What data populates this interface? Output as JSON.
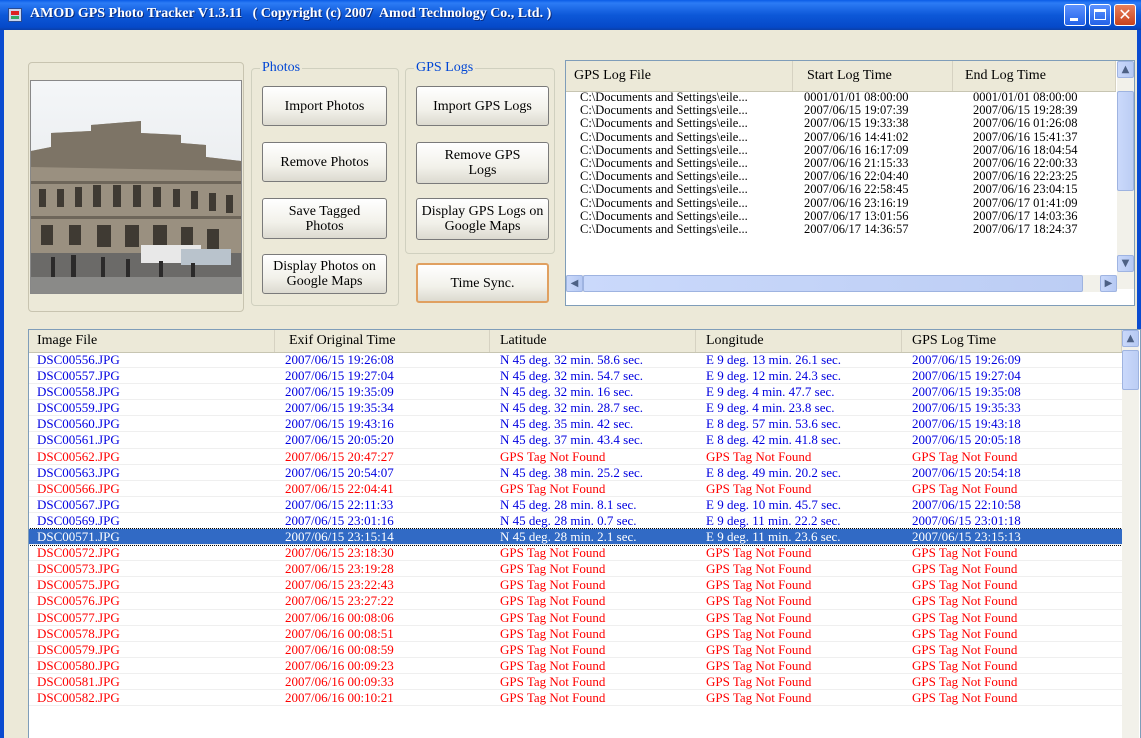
{
  "window": {
    "title": "AMOD GPS Photo Tracker V1.3.11   ( Copyright (c) 2007  Amod Technology Co., Ltd. )",
    "close_glyph": "✕"
  },
  "photos_group": {
    "label": "Photos",
    "import_label": "Import Photos",
    "remove_label": "Remove Photos",
    "save_label": "Save Tagged Photos",
    "display_label": "Display Photos on Google Maps"
  },
  "gps_group": {
    "label": "GPS Logs",
    "import_label": "Import GPS Logs",
    "remove_label": "Remove GPS Logs",
    "display_label": "Display GPS Logs on Google Maps",
    "timesync_label": "Time Sync."
  },
  "log_table": {
    "columns": [
      "GPS Log File",
      "Start Log Time",
      "End Log Time"
    ],
    "rows": [
      [
        "C:\\Documents and Settings\\eile...",
        "0001/01/01 08:00:00",
        "0001/01/01 08:00:00"
      ],
      [
        "C:\\Documents and Settings\\eile...",
        "2007/06/15 19:07:39",
        "2007/06/15 19:28:39"
      ],
      [
        "C:\\Documents and Settings\\eile...",
        "2007/06/15 19:33:38",
        "2007/06/16 01:26:08"
      ],
      [
        "C:\\Documents and Settings\\eile...",
        "2007/06/16 14:41:02",
        "2007/06/16 15:41:37"
      ],
      [
        "C:\\Documents and Settings\\eile...",
        "2007/06/16 16:17:09",
        "2007/06/16 18:04:54"
      ],
      [
        "C:\\Documents and Settings\\eile...",
        "2007/06/16 21:15:33",
        "2007/06/16 22:00:33"
      ],
      [
        "C:\\Documents and Settings\\eile...",
        "2007/06/16 22:04:40",
        "2007/06/16 22:23:25"
      ],
      [
        "C:\\Documents and Settings\\eile...",
        "2007/06/16 22:58:45",
        "2007/06/16 23:04:15"
      ],
      [
        "C:\\Documents and Settings\\eile...",
        "2007/06/16 23:16:19",
        "2007/06/17 01:41:09"
      ],
      [
        "C:\\Documents and Settings\\eile...",
        "2007/06/17 13:01:56",
        "2007/06/17 14:03:36"
      ],
      [
        "C:\\Documents and Settings\\eile...",
        "2007/06/17 14:36:57",
        "2007/06/17 18:24:37"
      ]
    ]
  },
  "image_table": {
    "columns": [
      "Image File",
      "Exif Original Time",
      "Latitude",
      "Longitude",
      "GPS Log Time"
    ],
    "rows": [
      {
        "status": "found",
        "cells": [
          "DSC00556.JPG",
          "2007/06/15 19:26:08",
          "N 45 deg. 32 min. 58.6 sec.",
          "E 9 deg. 13 min. 26.1 sec.",
          "2007/06/15 19:26:09"
        ]
      },
      {
        "status": "found",
        "cells": [
          "DSC00557.JPG",
          "2007/06/15 19:27:04",
          "N 45 deg. 32 min. 54.7 sec.",
          "E 9 deg. 12 min. 24.3 sec.",
          "2007/06/15 19:27:04"
        ]
      },
      {
        "status": "found",
        "cells": [
          "DSC00558.JPG",
          "2007/06/15 19:35:09",
          "N 45 deg. 32 min. 16 sec.",
          "E 9 deg. 4 min. 47.7 sec.",
          "2007/06/15 19:35:08"
        ]
      },
      {
        "status": "found",
        "cells": [
          "DSC00559.JPG",
          "2007/06/15 19:35:34",
          "N 45 deg. 32 min. 28.7 sec.",
          "E 9 deg. 4 min. 23.8 sec.",
          "2007/06/15 19:35:33"
        ]
      },
      {
        "status": "found",
        "cells": [
          "DSC00560.JPG",
          "2007/06/15 19:43:16",
          "N 45 deg. 35 min. 42 sec.",
          "E 8 deg. 57 min. 53.6 sec.",
          "2007/06/15 19:43:18"
        ]
      },
      {
        "status": "found",
        "cells": [
          "DSC00561.JPG",
          "2007/06/15 20:05:20",
          "N 45 deg. 37 min. 43.4 sec.",
          "E 8 deg. 42 min. 41.8 sec.",
          "2007/06/15 20:05:18"
        ]
      },
      {
        "status": "missing",
        "cells": [
          "DSC00562.JPG",
          "2007/06/15 20:47:27",
          "GPS Tag Not Found",
          "GPS Tag Not Found",
          "GPS Tag Not Found"
        ]
      },
      {
        "status": "found",
        "cells": [
          "DSC00563.JPG",
          "2007/06/15 20:54:07",
          "N 45 deg. 38 min. 25.2 sec.",
          "E 8 deg. 49 min. 20.2 sec.",
          "2007/06/15 20:54:18"
        ]
      },
      {
        "status": "missing",
        "cells": [
          "DSC00566.JPG",
          "2007/06/15 22:04:41",
          "GPS Tag Not Found",
          "GPS Tag Not Found",
          "GPS Tag Not Found"
        ]
      },
      {
        "status": "found",
        "cells": [
          "DSC00567.JPG",
          "2007/06/15 22:11:33",
          "N 45 deg. 28 min. 8.1 sec.",
          "E 9 deg. 10 min. 45.7 sec.",
          "2007/06/15 22:10:58"
        ]
      },
      {
        "status": "found",
        "cells": [
          "DSC00569.JPG",
          "2007/06/15 23:01:16",
          "N 45 deg. 28 min. 0.7 sec.",
          "E 9 deg. 11 min. 22.2 sec.",
          "2007/06/15 23:01:18"
        ]
      },
      {
        "status": "selected",
        "cells": [
          "DSC00571.JPG",
          "2007/06/15 23:15:14",
          "N 45 deg. 28 min. 2.1 sec.",
          "E 9 deg. 11 min. 23.6 sec.",
          "2007/06/15 23:15:13"
        ]
      },
      {
        "status": "missing",
        "cells": [
          "DSC00572.JPG",
          "2007/06/15 23:18:30",
          "GPS Tag Not Found",
          "GPS Tag Not Found",
          "GPS Tag Not Found"
        ]
      },
      {
        "status": "missing",
        "cells": [
          "DSC00573.JPG",
          "2007/06/15 23:19:28",
          "GPS Tag Not Found",
          "GPS Tag Not Found",
          "GPS Tag Not Found"
        ]
      },
      {
        "status": "missing",
        "cells": [
          "DSC00575.JPG",
          "2007/06/15 23:22:43",
          "GPS Tag Not Found",
          "GPS Tag Not Found",
          "GPS Tag Not Found"
        ]
      },
      {
        "status": "missing",
        "cells": [
          "DSC00576.JPG",
          "2007/06/15 23:27:22",
          "GPS Tag Not Found",
          "GPS Tag Not Found",
          "GPS Tag Not Found"
        ]
      },
      {
        "status": "missing",
        "cells": [
          "DSC00577.JPG",
          "2007/06/16 00:08:06",
          "GPS Tag Not Found",
          "GPS Tag Not Found",
          "GPS Tag Not Found"
        ]
      },
      {
        "status": "missing",
        "cells": [
          "DSC00578.JPG",
          "2007/06/16 00:08:51",
          "GPS Tag Not Found",
          "GPS Tag Not Found",
          "GPS Tag Not Found"
        ]
      },
      {
        "status": "missing",
        "cells": [
          "DSC00579.JPG",
          "2007/06/16 00:08:59",
          "GPS Tag Not Found",
          "GPS Tag Not Found",
          "GPS Tag Not Found"
        ]
      },
      {
        "status": "missing",
        "cells": [
          "DSC00580.JPG",
          "2007/06/16 00:09:23",
          "GPS Tag Not Found",
          "GPS Tag Not Found",
          "GPS Tag Not Found"
        ]
      },
      {
        "status": "missing",
        "cells": [
          "DSC00581.JPG",
          "2007/06/16 00:09:33",
          "GPS Tag Not Found",
          "GPS Tag Not Found",
          "GPS Tag Not Found"
        ]
      },
      {
        "status": "missing",
        "cells": [
          "DSC00582.JPG",
          "2007/06/16 00:10:21",
          "GPS Tag Not Found",
          "GPS Tag Not Found",
          "GPS Tag Not Found"
        ]
      }
    ]
  },
  "colors": {
    "found_text": "#0000e0",
    "missing_text": "#ff0000",
    "selection": "#316ac5",
    "titlebar": "#0a5ce6"
  },
  "icons": {
    "app": "app-icon",
    "minimize": "minimize-icon",
    "maximize": "maximize-icon",
    "close": "close-icon",
    "scroll_up": "arrow-up-icon",
    "scroll_down": "arrow-down-icon",
    "scroll_left": "arrow-left-icon",
    "scroll_right": "arrow-right-icon"
  }
}
